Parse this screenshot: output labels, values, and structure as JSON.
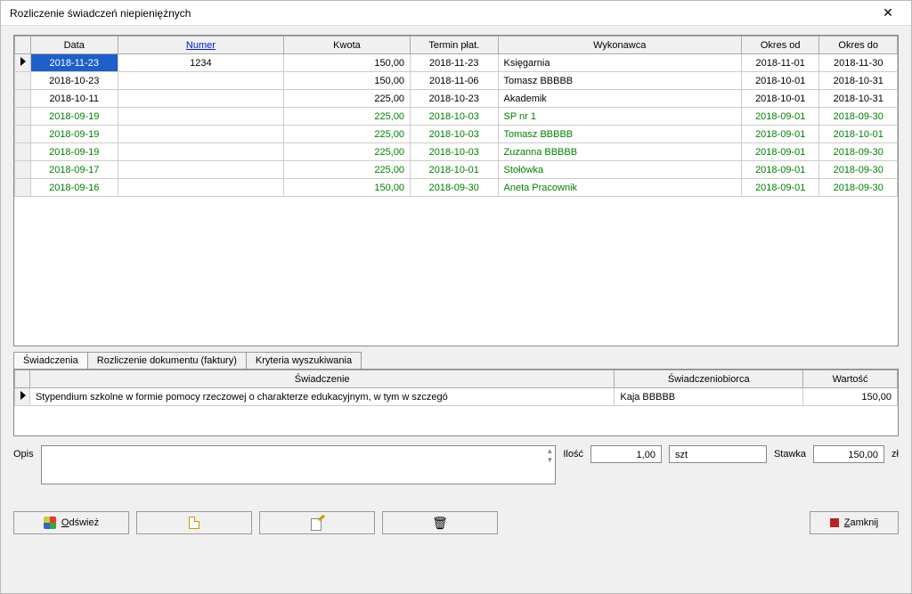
{
  "window": {
    "title": "Rozliczenie świadczeń niepieniężnych"
  },
  "grid": {
    "headers": {
      "data": "Data",
      "numer": "Numer",
      "kwota": "Kwota",
      "termin": "Termin płat.",
      "wykonawca": "Wykonawca",
      "okres_od": "Okres od",
      "okres_do": "Okres do"
    },
    "rows": [
      {
        "data": "2018-11-23",
        "numer": "1234",
        "kwota": "150,00",
        "termin": "2018-11-23",
        "wykonawca": "Księgarnia",
        "okres_od": "2018-11-01",
        "okres_do": "2018-11-30",
        "green": false,
        "selected": true
      },
      {
        "data": "2018-10-23",
        "numer": "",
        "kwota": "150,00",
        "termin": "2018-11-06",
        "wykonawca": "Tomasz BBBBB",
        "okres_od": "2018-10-01",
        "okres_do": "2018-10-31",
        "green": false
      },
      {
        "data": "2018-10-11",
        "numer": "",
        "kwota": "225,00",
        "termin": "2018-10-23",
        "wykonawca": "Akademik",
        "okres_od": "2018-10-01",
        "okres_do": "2018-10-31",
        "green": false
      },
      {
        "data": "2018-09-19",
        "numer": "",
        "kwota": "225,00",
        "termin": "2018-10-03",
        "wykonawca": "SP nr 1",
        "okres_od": "2018-09-01",
        "okres_do": "2018-09-30",
        "green": true
      },
      {
        "data": "2018-09-19",
        "numer": "",
        "kwota": "225,00",
        "termin": "2018-10-03",
        "wykonawca": "Tomasz BBBBB",
        "okres_od": "2018-09-01",
        "okres_do": "2018-10-01",
        "green": true
      },
      {
        "data": "2018-09-19",
        "numer": "",
        "kwota": "225,00",
        "termin": "2018-10-03",
        "wykonawca": "Zuzanna BBBBB",
        "okres_od": "2018-09-01",
        "okres_do": "2018-09-30",
        "green": true
      },
      {
        "data": "2018-09-17",
        "numer": "",
        "kwota": "225,00",
        "termin": "2018-10-01",
        "wykonawca": "Stołówka",
        "okres_od": "2018-09-01",
        "okres_do": "2018-09-30",
        "green": true
      },
      {
        "data": "2018-09-16",
        "numer": "",
        "kwota": "150,00",
        "termin": "2018-09-30",
        "wykonawca": "Aneta Pracownik",
        "okres_od": "2018-09-01",
        "okres_do": "2018-09-30",
        "green": true
      }
    ]
  },
  "tabs": {
    "swiadczenia": "Świadczenia",
    "rozliczenie": "Rozliczenie dokumentu (faktury)",
    "kryteria": "Kryteria wyszukiwania"
  },
  "detail": {
    "headers": {
      "swiadczenie": "Świadczenie",
      "biorca": "Świadczeniobiorca",
      "wartosc": "Wartość"
    },
    "row": {
      "swiadczenie": "Stypendium szkolne w formie pomocy rzeczowej o charakterze edukacyjnym, w tym w szczegó",
      "biorca": "Kaja BBBBB",
      "wartosc": "150,00"
    }
  },
  "form": {
    "opis_label": "Opis",
    "ilosc_label": "Ilość",
    "ilosc_value": "1,00",
    "jm_value": "szt",
    "stawka_label": "Stawka",
    "stawka_value": "150,00",
    "waluta": "zł"
  },
  "buttons": {
    "odswiez": "Odśwież",
    "zamknij": "Zamknij"
  }
}
